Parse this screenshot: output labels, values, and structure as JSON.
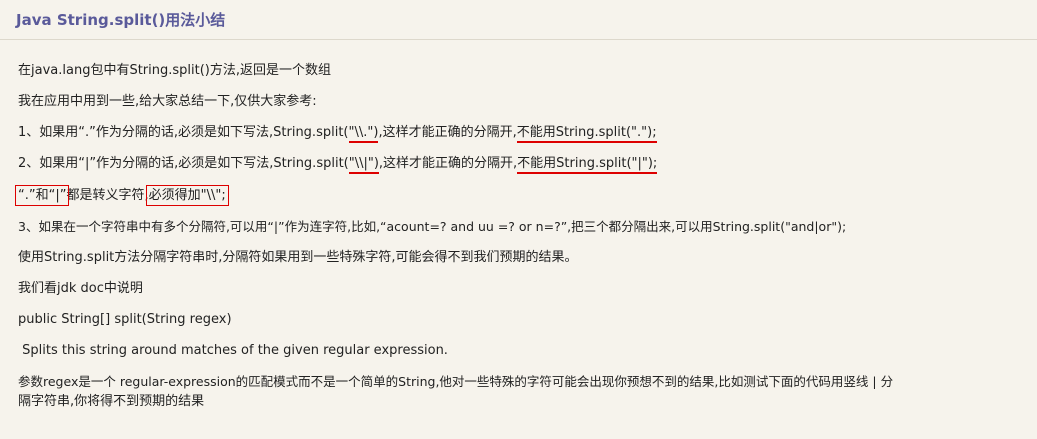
{
  "title": "Java String.split()用法小结",
  "p1": "在java.lang包中有String.split()方法,返回是一个数组",
  "p2": "我在应用中用到一些,给大家总结一下,仅供大家参考:",
  "p3": {
    "a": "1、如果用“.”作为分隔的话,必须是如下写法,String.split(",
    "b": "\"\\\\.\")",
    "c": ",这样才能正确的分隔开,",
    "d": "不能用String.split(\".\");"
  },
  "p4": {
    "a": "2、如果用“|”作为分隔的话,必须是如下写法,String.split(",
    "b": "\"\\\\|\")",
    "c": ",这样才能正确的分隔开,",
    "d": "不能用String.split(\"|\");"
  },
  "p5": {
    "a": "“.”和“|”",
    "b": "都是转义字符,",
    "c": "必须得加\"\\\\\";"
  },
  "p6": "3、如果在一个字符串中有多个分隔符,可以用“|”作为连字符,比如,“acount=? and uu =? or n=?”,把三个都分隔出来,可以用String.split(\"and|or\");",
  "p7": "使用String.split方法分隔字符串时,分隔符如果用到一些特殊字符,可能会得不到我们预期的结果。",
  "p8": "我们看jdk doc中说明",
  "p9": "public String[] split(String regex)",
  "p10": " Splits this string around matches of the given regular expression.",
  "p11a": "参数regex是一个 regular-expression的匹配模式而不是一个简单的String,他对一些特殊的字符可能会出现你预想不到的结果,比如测试下面的代码用竖线 | 分",
  "p11b": "隔字符串,你将得不到预期的结果"
}
